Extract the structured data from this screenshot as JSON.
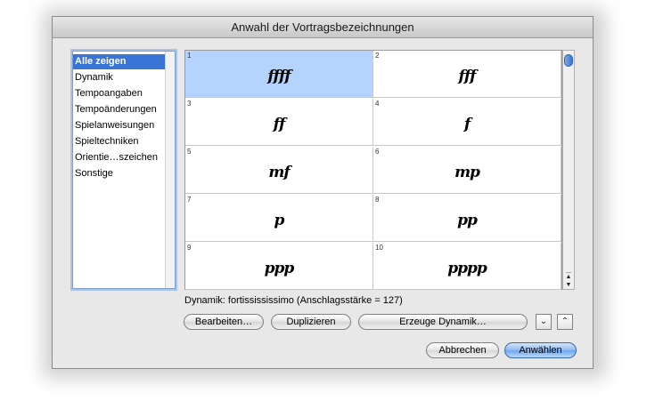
{
  "window": {
    "title": "Anwahl der Vortragsbezeichnungen"
  },
  "categories": [
    "Alle zeigen",
    "Dynamik",
    "Tempoangaben",
    "Tempoänderungen",
    "Spielanweisungen",
    "Spieltechniken",
    "Orientie…szeichen",
    "Sonstige"
  ],
  "selected_category_index": 0,
  "markings": [
    {
      "num": "1",
      "glyph": "ffff"
    },
    {
      "num": "2",
      "glyph": "fff"
    },
    {
      "num": "3",
      "glyph": "ff"
    },
    {
      "num": "4",
      "glyph": "f"
    },
    {
      "num": "5",
      "glyph": "mf"
    },
    {
      "num": "6",
      "glyph": "mp"
    },
    {
      "num": "7",
      "glyph": "p"
    },
    {
      "num": "8",
      "glyph": "pp"
    },
    {
      "num": "9",
      "glyph": "ppp"
    },
    {
      "num": "10",
      "glyph": "pppp"
    }
  ],
  "selected_marking_index": 0,
  "status_text": "Dynamik: fortissississimo (Anschlagsstärke = 127)",
  "buttons": {
    "edit": "Bearbeiten…",
    "duplicate": "Duplizieren",
    "create_dynamic": "Erzeuge Dynamik…",
    "cancel": "Abbrechen",
    "select": "Anwählen"
  },
  "scroll_arrows": {
    "up": "▲",
    "down": "▼"
  },
  "nav_glyphs": {
    "down": "⌄",
    "up": "⌃"
  },
  "colors": {
    "selection_blue": "#3875d7",
    "cell_selection": "#b5d3ff",
    "default_button": "#6ea5ea"
  }
}
